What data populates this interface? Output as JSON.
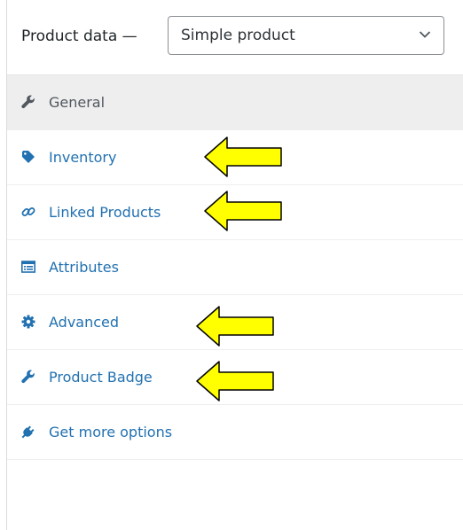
{
  "header": {
    "title": "Product data —",
    "product_type": "Simple product"
  },
  "tabs": [
    {
      "label": "General",
      "icon": "wrench-icon",
      "active": true
    },
    {
      "label": "Inventory",
      "icon": "tag-icon",
      "active": false
    },
    {
      "label": "Linked Products",
      "icon": "link-icon",
      "active": false
    },
    {
      "label": "Attributes",
      "icon": "list-icon",
      "active": false
    },
    {
      "label": "Advanced",
      "icon": "gear-icon",
      "active": false
    },
    {
      "label": "Product Badge",
      "icon": "wrench-icon",
      "active": false
    },
    {
      "label": "Get more options",
      "icon": "plugin-icon",
      "active": false
    }
  ],
  "colors": {
    "link": "#2271b1",
    "active_text": "#50575e",
    "active_bg": "#eeeeee",
    "arrow_fill": "#ffff00",
    "arrow_stroke": "#000000"
  }
}
